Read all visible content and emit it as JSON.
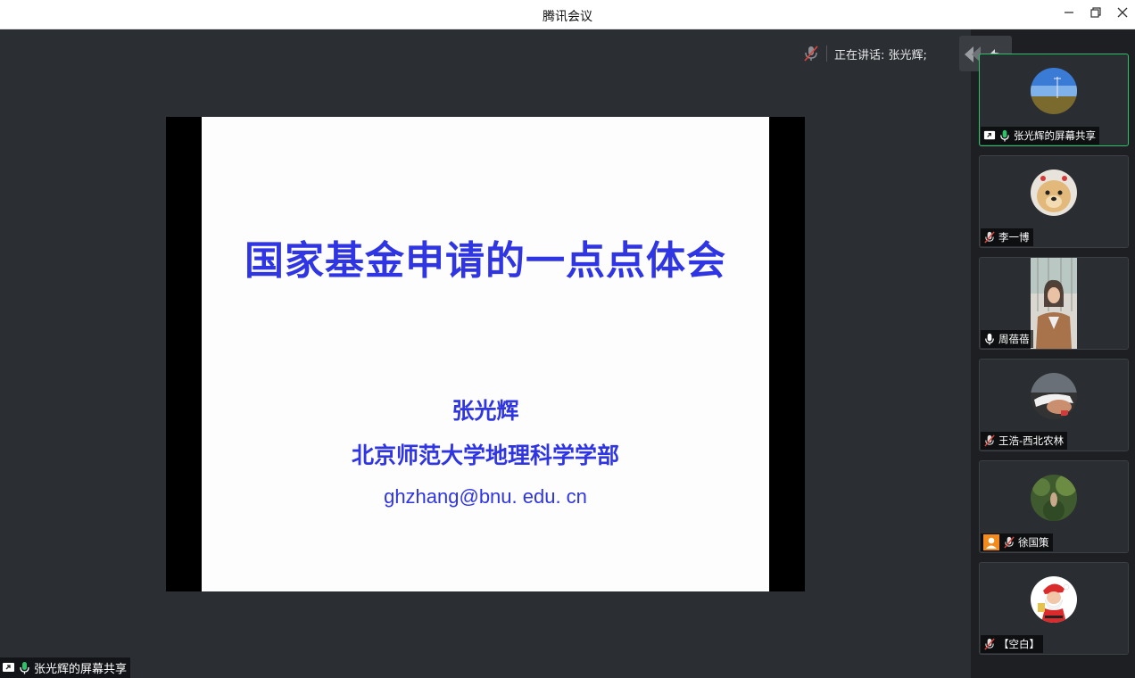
{
  "window": {
    "title": "腾讯会议",
    "minimize_icon": "minimize-icon",
    "restore_icon": "restore-icon",
    "close_icon": "close-icon"
  },
  "speaking_bar": {
    "label": "正在讲话: 张光辉;",
    "mic_icon": "mic-muted-icon"
  },
  "controls": {
    "icons": [
      "layout-toggle-icon",
      "collapse-arrow-icon"
    ]
  },
  "slide": {
    "title": "国家基金申请的一点点体会",
    "author": "张光辉",
    "affiliation": "北京师范大学地理科学学部",
    "email": "ghzhang@bnu. edu. cn",
    "text_color": "#2f35e2"
  },
  "share_tag": {
    "label": "张光辉的屏幕共享"
  },
  "participants": [
    {
      "name": "张光辉的屏幕共享",
      "mic": "mic-on",
      "screen_share": true,
      "active": true,
      "avatar": "landscape"
    },
    {
      "name": "李一博",
      "mic": "mic-muted",
      "avatar": "dog"
    },
    {
      "name": "周蓓蓓",
      "mic": "mic-on",
      "avatar": "video-person"
    },
    {
      "name": "王浩-西北农林",
      "mic": "mic-muted",
      "avatar": "hands"
    },
    {
      "name": "徐国策",
      "mic": "mic-muted",
      "host": true,
      "avatar": "forest"
    },
    {
      "name": "【空白】",
      "mic": "mic-muted",
      "avatar": "santa"
    }
  ],
  "colors": {
    "stage_bg": "#2b2e33",
    "sidebar_bg": "#1d1f22",
    "active_border": "#2fc06a",
    "mic_on": "#2fc06a",
    "host_badge": "#f28a1d"
  }
}
